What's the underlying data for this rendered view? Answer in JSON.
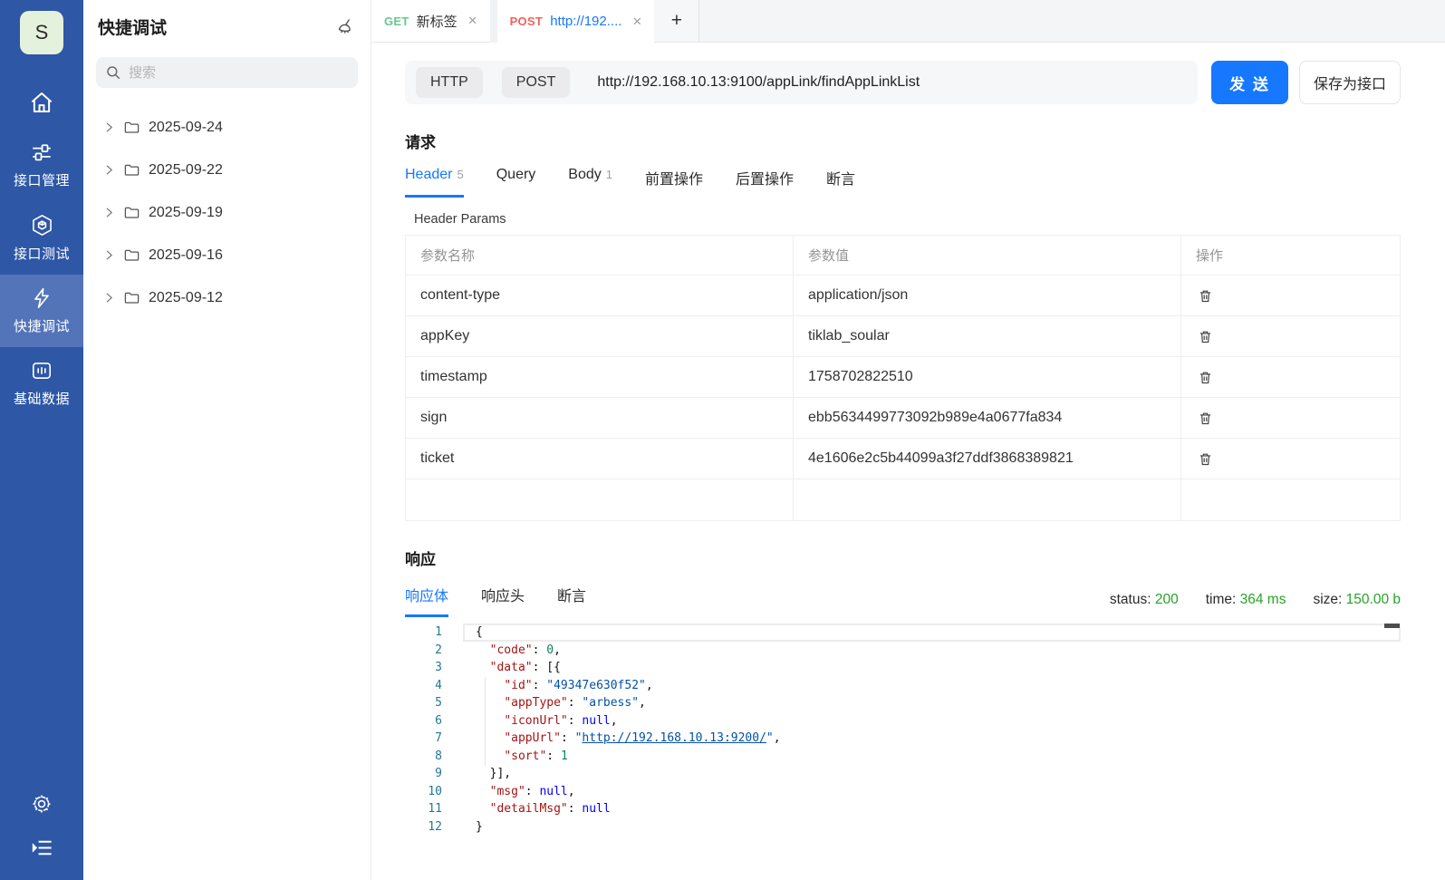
{
  "colors": {
    "sidebar_blue": "#2e57a6",
    "accent_blue": "#1677ff",
    "get_green": "#66c88f",
    "post_red": "#f5605c",
    "status_green": "#27a327"
  },
  "sidebar": {
    "logo": "S",
    "nav": [
      {
        "label": "接口管理"
      },
      {
        "label": "接口测试"
      },
      {
        "label": "快捷调试"
      },
      {
        "label": "基础数据"
      }
    ]
  },
  "tree": {
    "title": "快捷调试",
    "search_placeholder": "搜索",
    "folders": [
      "2025-09-24",
      "2025-09-22",
      "2025-09-19",
      "2025-09-16",
      "2025-09-12"
    ]
  },
  "tabs": {
    "tab1": {
      "method": "GET",
      "label": "新标签",
      "close": "×"
    },
    "tab2": {
      "method": "POST",
      "label": "http://192....",
      "close": "×"
    },
    "add": "+"
  },
  "request_bar": {
    "protocol": "HTTP",
    "method": "POST",
    "url": "http://192.168.10.13:9100/appLink/findAppLinkList",
    "send": "发 送",
    "save": "保存为接口"
  },
  "request": {
    "title": "请求",
    "tabs": [
      {
        "label": "Header",
        "count": "5"
      },
      {
        "label": "Query",
        "count": ""
      },
      {
        "label": "Body",
        "count": "1"
      },
      {
        "label": "前置操作",
        "count": ""
      },
      {
        "label": "后置操作",
        "count": ""
      },
      {
        "label": "断言",
        "count": ""
      }
    ],
    "params_label": "Header Params",
    "table": {
      "headers": [
        "参数名称",
        "参数值",
        "操作"
      ],
      "rows": [
        {
          "name": "content-type",
          "value": "application/json"
        },
        {
          "name": "appKey",
          "value": "tiklab_soular"
        },
        {
          "name": "timestamp",
          "value": "1758702822510"
        },
        {
          "name": "sign",
          "value": "ebb5634499773092b989e4a0677fa834"
        },
        {
          "name": "ticket",
          "value": "4e1606e2c5b44099a3f27ddf3868389821"
        }
      ]
    }
  },
  "response": {
    "title": "响应",
    "tabs": [
      "响应体",
      "响应头",
      "断言"
    ],
    "status_label": "status:",
    "status_value": "200",
    "time_label": "time:",
    "time_value": "364 ms",
    "size_label": "size:",
    "size_value": "150.00 b",
    "editor": {
      "lines": [
        {
          "num": "1",
          "current": true,
          "tokens": [
            [
              "p",
              "{"
            ]
          ]
        },
        {
          "num": "2",
          "tokens": [
            [
              "p",
              "  "
            ],
            [
              "key",
              "\"code\""
            ],
            [
              "p",
              ": "
            ],
            [
              "num",
              "0"
            ],
            [
              "p",
              ","
            ]
          ]
        },
        {
          "num": "3",
          "tokens": [
            [
              "p",
              "  "
            ],
            [
              "key",
              "\"data\""
            ],
            [
              "p",
              ": [{"
            ]
          ]
        },
        {
          "num": "4",
          "tokens": [
            [
              "p",
              "    "
            ],
            [
              "key",
              "\"id\""
            ],
            [
              "p",
              ": "
            ],
            [
              "str",
              "\"49347e630f52\""
            ],
            [
              "p",
              ","
            ]
          ]
        },
        {
          "num": "5",
          "tokens": [
            [
              "p",
              "    "
            ],
            [
              "key",
              "\"appType\""
            ],
            [
              "p",
              ": "
            ],
            [
              "str",
              "\"arbess\""
            ],
            [
              "p",
              ","
            ]
          ]
        },
        {
          "num": "6",
          "tokens": [
            [
              "p",
              "    "
            ],
            [
              "key",
              "\"iconUrl\""
            ],
            [
              "p",
              ": "
            ],
            [
              "kw",
              "null"
            ],
            [
              "p",
              ","
            ]
          ]
        },
        {
          "num": "7",
          "tokens": [
            [
              "p",
              "    "
            ],
            [
              "key",
              "\"appUrl\""
            ],
            [
              "p",
              ": "
            ],
            [
              "str",
              "\""
            ],
            [
              "link",
              "http://192.168.10.13:9200/"
            ],
            [
              "str",
              "\""
            ],
            [
              "p",
              ","
            ]
          ]
        },
        {
          "num": "8",
          "tokens": [
            [
              "p",
              "    "
            ],
            [
              "key",
              "\"sort\""
            ],
            [
              "p",
              ": "
            ],
            [
              "num",
              "1"
            ]
          ]
        },
        {
          "num": "9",
          "tokens": [
            [
              "p",
              "  }],"
            ]
          ]
        },
        {
          "num": "10",
          "tokens": [
            [
              "p",
              "  "
            ],
            [
              "key",
              "\"msg\""
            ],
            [
              "p",
              ": "
            ],
            [
              "kw",
              "null"
            ],
            [
              "p",
              ","
            ]
          ]
        },
        {
          "num": "11",
          "tokens": [
            [
              "p",
              "  "
            ],
            [
              "key",
              "\"detailMsg\""
            ],
            [
              "p",
              ": "
            ],
            [
              "kw",
              "null"
            ]
          ]
        },
        {
          "num": "12",
          "tokens": [
            [
              "p",
              "}"
            ]
          ]
        }
      ]
    }
  }
}
